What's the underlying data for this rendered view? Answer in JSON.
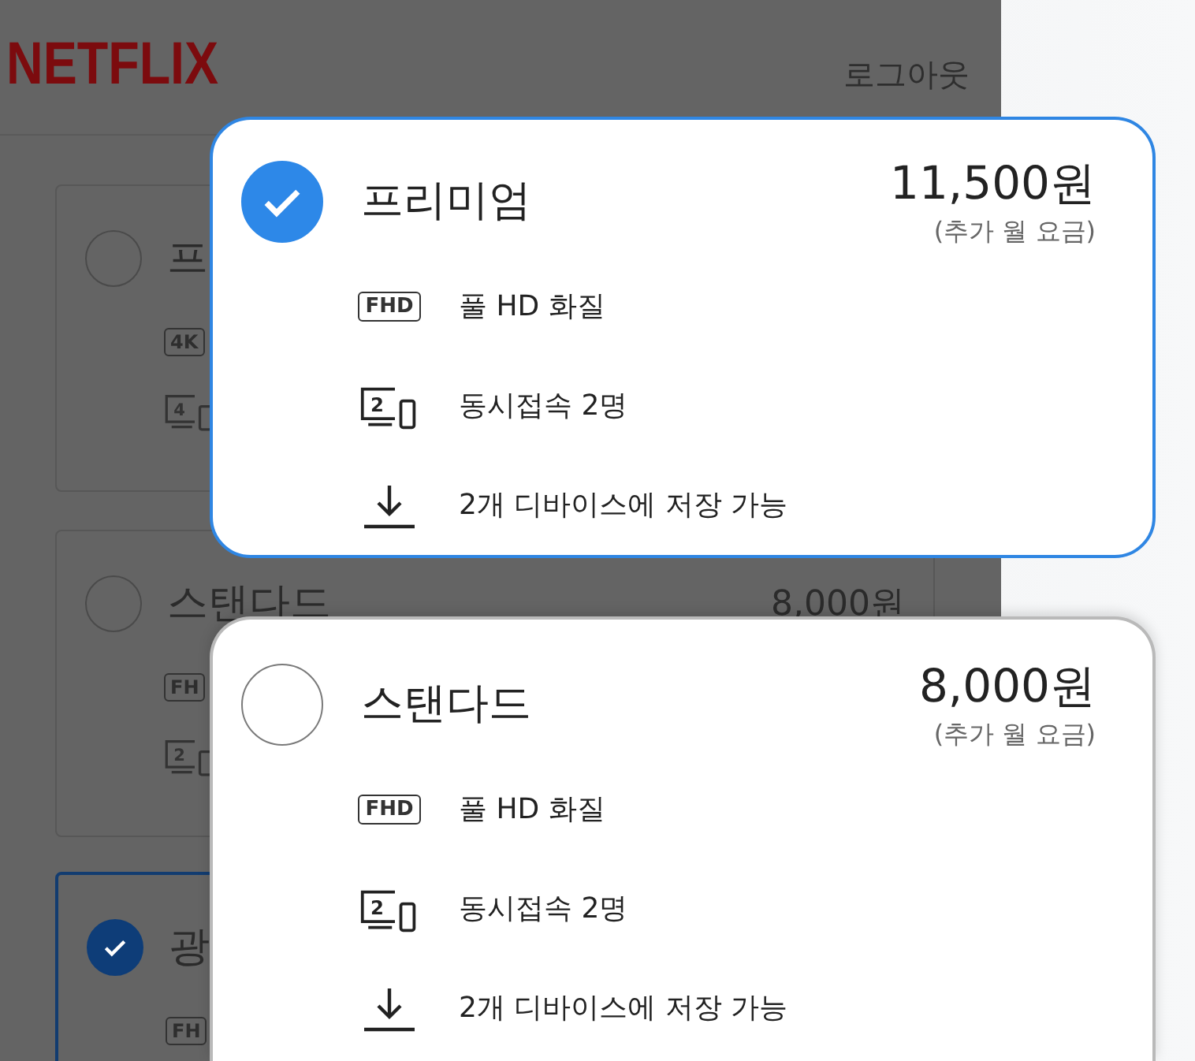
{
  "background_app": {
    "logo": "NETFLIX",
    "logout": "로그아웃",
    "plans": [
      {
        "name": "프",
        "selected": false,
        "features": [
          {
            "kind": "quality",
            "badge": "4K"
          },
          {
            "kind": "screens",
            "badge": "4"
          }
        ]
      },
      {
        "name": "스탠다드",
        "price": "8,000원",
        "selected": false,
        "features": [
          {
            "kind": "quality",
            "badge": "FH"
          },
          {
            "kind": "screens",
            "badge": "2"
          }
        ]
      },
      {
        "name": "광",
        "selected": true,
        "features": [
          {
            "kind": "quality",
            "badge": "FH"
          }
        ]
      }
    ]
  },
  "plan_cards": [
    {
      "name": "프리미엄",
      "price": "11,500원",
      "price_note": "(추가 월 요금)",
      "selected": true,
      "features": [
        {
          "kind": "quality",
          "badge": "FHD",
          "text": "풀 HD 화질"
        },
        {
          "kind": "screens",
          "badge": "2",
          "text": "동시접속 2명"
        },
        {
          "kind": "download",
          "text": "2개 디바이스에 저장 가능"
        }
      ]
    },
    {
      "name": "스탠다드",
      "price": "8,000원",
      "price_note": "(추가 월 요금)",
      "selected": false,
      "features": [
        {
          "kind": "quality",
          "badge": "FHD",
          "text": "풀 HD 화질"
        },
        {
          "kind": "screens",
          "badge": "2",
          "text": "동시접속 2명"
        },
        {
          "kind": "download",
          "text": "2개 디바이스에 저장 가능"
        }
      ]
    }
  ]
}
